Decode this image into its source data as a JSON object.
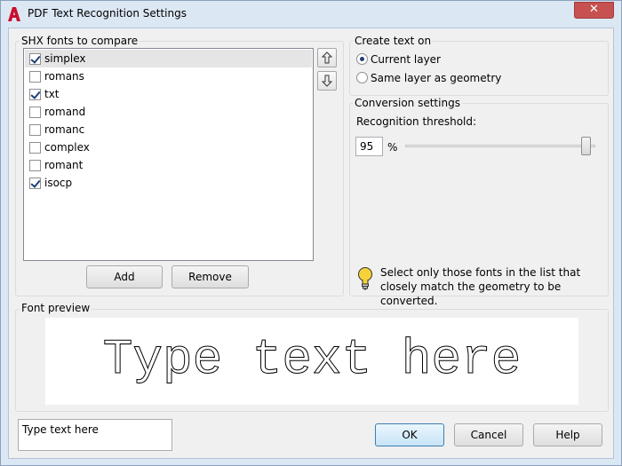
{
  "window": {
    "title": "PDF Text Recognition Settings",
    "close_glyph": "✕"
  },
  "fonts_group": {
    "label": "SHX fonts to compare",
    "items": [
      {
        "label": "simplex",
        "checked": true,
        "selected": true
      },
      {
        "label": "romans",
        "checked": false,
        "selected": false
      },
      {
        "label": "txt",
        "checked": true,
        "selected": false
      },
      {
        "label": "romand",
        "checked": false,
        "selected": false
      },
      {
        "label": "romanc",
        "checked": false,
        "selected": false
      },
      {
        "label": "complex",
        "checked": false,
        "selected": false
      },
      {
        "label": "romant",
        "checked": false,
        "selected": false
      },
      {
        "label": "isocp",
        "checked": true,
        "selected": false
      }
    ],
    "add_label": "Add",
    "remove_label": "Remove",
    "move_up_icon": "move-up-icon",
    "move_down_icon": "move-down-icon"
  },
  "create_text": {
    "label": "Create text on",
    "options": [
      {
        "label": "Current layer",
        "checked": true
      },
      {
        "label": "Same layer as geometry",
        "checked": false
      }
    ]
  },
  "conversion": {
    "label": "Conversion settings",
    "threshold_label": "Recognition threshold:",
    "threshold_value": "95",
    "threshold_unit": "%",
    "threshold_fraction": 0.95,
    "tip": "Select only those fonts in the list that closely match the geometry to be converted."
  },
  "preview": {
    "label": "Font preview",
    "sample_text": "Type text here"
  },
  "sample_input": {
    "value": "Type text here"
  },
  "footer": {
    "ok_label": "OK",
    "cancel_label": "Cancel",
    "help_label": "Help"
  },
  "colors": {
    "title_background": "#dce7f4",
    "close_button": "#c75050",
    "app_icon_red": "#c8102e"
  }
}
